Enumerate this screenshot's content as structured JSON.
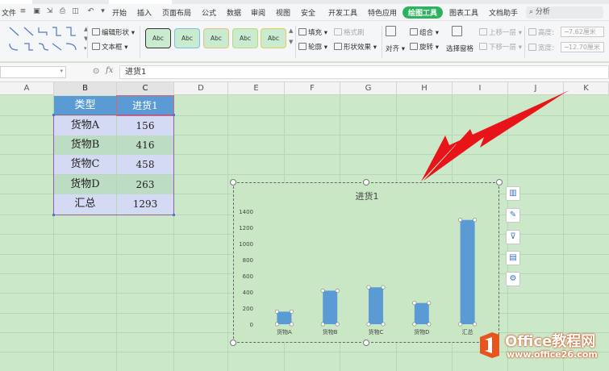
{
  "menu": {
    "file": "文件",
    "tabs": [
      "开始",
      "插入",
      "页面布局",
      "公式",
      "数据",
      "审阅",
      "视图",
      "安全",
      "开发工具",
      "特色应用",
      "绘图工具",
      "图表工具",
      "文档助手"
    ],
    "active_tab": "绘图工具",
    "search": "分析"
  },
  "ribbon": {
    "edit_shape": "编辑形状",
    "text_box": "文本框",
    "style_label": "Abc",
    "fill": "填充",
    "format_brush": "格式刷",
    "outline": "轮廓",
    "shape_effect": "形状效果",
    "align": "对齐",
    "group": "组合",
    "rotate": "旋转",
    "selection_pane": "选择窗格",
    "bring_forward": "上移一层",
    "send_backward": "下移一层",
    "height_label": "高度:",
    "height_value": "7.62厘米",
    "width_label": "宽度:",
    "width_value": "12.70厘米"
  },
  "formula_bar": {
    "name_box": "",
    "fx": "fx",
    "content": "进货1"
  },
  "columns": [
    "A",
    "B",
    "C",
    "D",
    "E",
    "F",
    "G",
    "H",
    "I",
    "J",
    "K"
  ],
  "table": {
    "header": [
      "类型",
      "进货1"
    ],
    "rows": [
      [
        "货物A",
        "156"
      ],
      [
        "货物B",
        "416"
      ],
      [
        "货物C",
        "458"
      ],
      [
        "货物D",
        "263"
      ],
      [
        "汇总",
        "1293"
      ]
    ]
  },
  "chart_data": {
    "type": "bar",
    "title": "进货1",
    "categories": [
      "货物A",
      "货物B",
      "货物C",
      "货物D",
      "汇总"
    ],
    "values": [
      156,
      416,
      458,
      263,
      1293
    ],
    "ylim": [
      0,
      1400
    ],
    "yticks": [
      "0",
      "200",
      "400",
      "600",
      "800",
      "1000",
      "1200",
      "1400"
    ],
    "xlabel": "",
    "ylabel": "",
    "grid": false,
    "legend": "none",
    "bar_color": "#5b9bd5"
  },
  "side_tools": [
    "chart-elements-icon",
    "chart-style-icon",
    "chart-filter-icon",
    "chart-type-icon",
    "chart-settings-icon"
  ],
  "watermark": {
    "name": "Office教程网",
    "url": "www.office26.com"
  },
  "colors": {
    "accent": "#2db35f",
    "header_fill": "#5b9bd5",
    "sheet_bg": "#cbe8c9",
    "arrow": "#e8141a"
  }
}
